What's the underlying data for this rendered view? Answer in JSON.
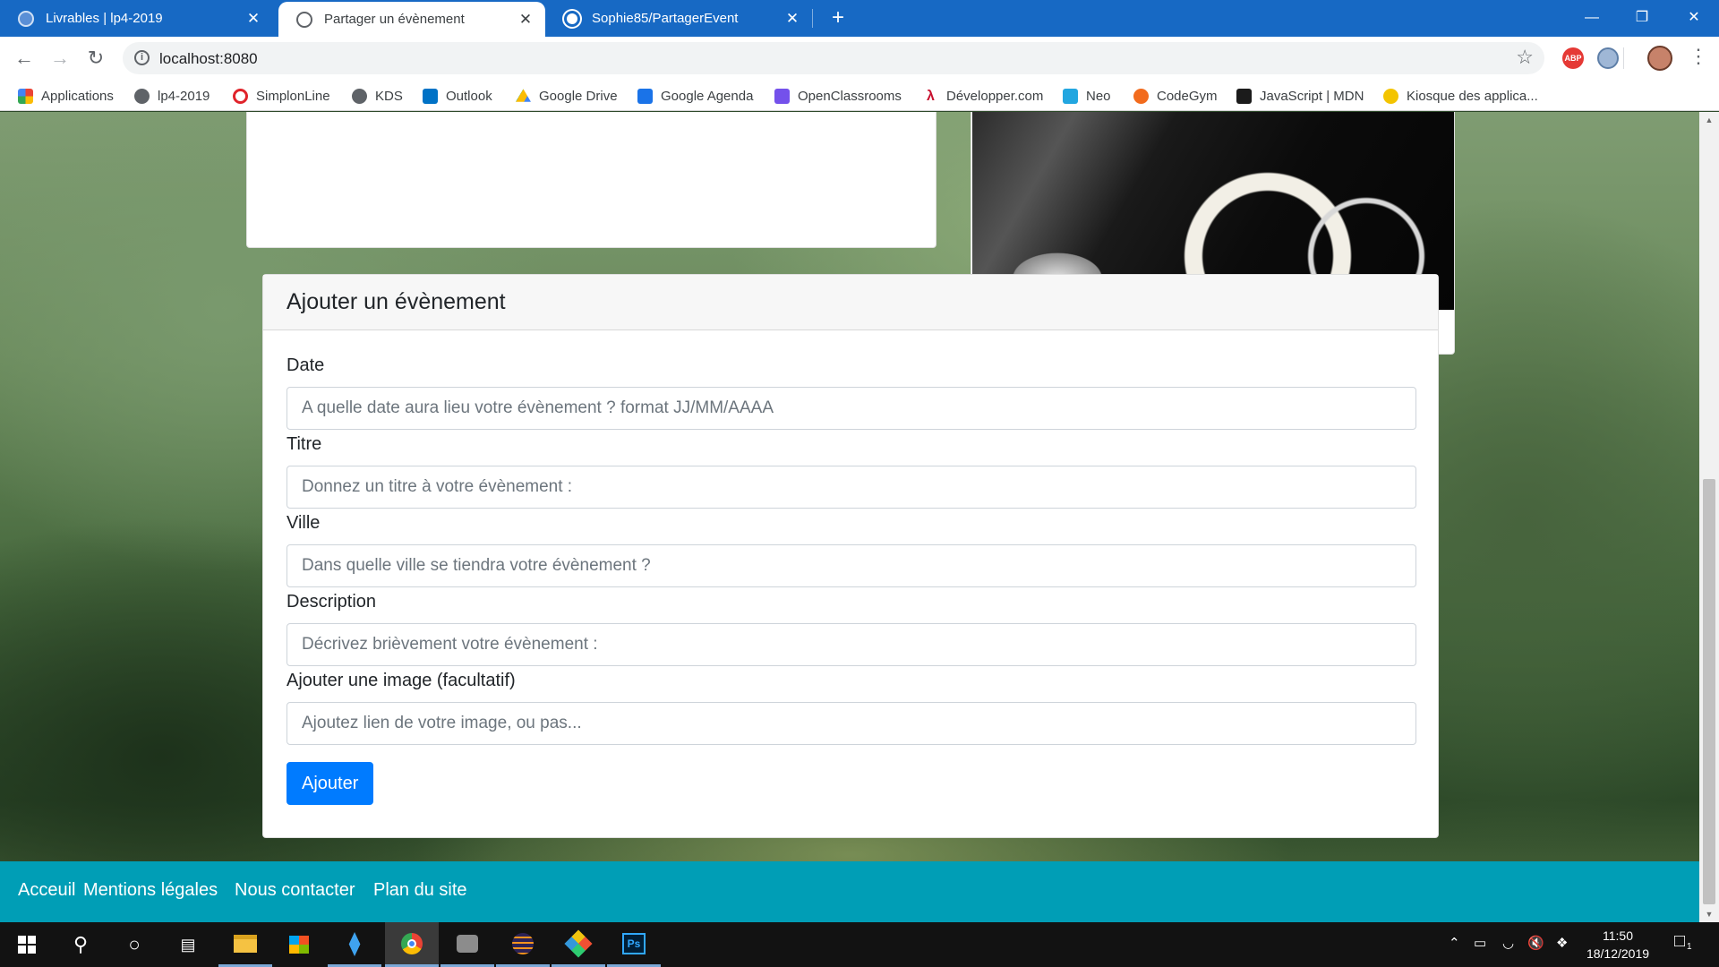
{
  "browser": {
    "tabs": [
      {
        "label": "Livrables | lp4-2019",
        "active": false
      },
      {
        "label": "Partager un évènement",
        "active": true
      },
      {
        "label": "Sophie85/PartagerEvent",
        "active": false
      }
    ],
    "url": "localhost:8080",
    "extensions": {
      "adblock": "ABP"
    }
  },
  "bookmarks": [
    {
      "label": "Applications",
      "icon": "apps-grid-icon",
      "color": "#ea4335"
    },
    {
      "label": "lp4-2019",
      "icon": "globe-icon",
      "color": "#5f6368"
    },
    {
      "label": "SimplonLine",
      "icon": "simplon-icon",
      "color": "#e0242b"
    },
    {
      "label": "KDS",
      "icon": "globe-icon",
      "color": "#5f6368"
    },
    {
      "label": "Outlook",
      "icon": "outlook-icon",
      "color": "#0072c6"
    },
    {
      "label": "Google Drive",
      "icon": "drive-icon",
      "color": "#fbbc04"
    },
    {
      "label": "Google Agenda",
      "icon": "calendar-icon",
      "color": "#1a73e8"
    },
    {
      "label": "OpenClassrooms",
      "icon": "openclassrooms-icon",
      "color": "#7451eb"
    },
    {
      "label": "Développer.com",
      "icon": "developpez-icon",
      "color": "#c8102e"
    },
    {
      "label": "Neo",
      "icon": "neo-icon",
      "color": "#22a6e0"
    },
    {
      "label": "CodeGym",
      "icon": "codegym-icon",
      "color": "#f26b1d"
    },
    {
      "label": "JavaScript | MDN",
      "icon": "mdn-icon",
      "color": "#1b1b1b"
    },
    {
      "label": "Kiosque des applica...",
      "icon": "kiosque-icon",
      "color": "#f3c400"
    }
  ],
  "form": {
    "title": "Ajouter un évènement",
    "fields": [
      {
        "label": "Date",
        "placeholder": "A quelle date aura lieu votre évènement ? format JJ/MM/AAAA"
      },
      {
        "label": "Titre",
        "placeholder": "Donnez un titre à votre évènement :"
      },
      {
        "label": "Ville",
        "placeholder": "Dans quelle ville se tiendra votre évènement ?"
      },
      {
        "label": "Description",
        "placeholder": "Décrivez brièvement votre évènement :"
      },
      {
        "label": "Ajouter une image (facultatif)",
        "placeholder": "Ajoutez lien de votre image, ou pas..."
      }
    ],
    "submit_label": "Ajouter"
  },
  "footer": {
    "links": [
      "Acceuil",
      "Mentions légales",
      "Nous contacter",
      "Plan du site"
    ]
  },
  "taskbar": {
    "time": "11:50",
    "date": "18/12/2019",
    "notification_count": "1"
  },
  "colors": {
    "chrome_tabstrip": "#1769c4",
    "primary_button": "#007bff",
    "footer": "#009eb6"
  }
}
